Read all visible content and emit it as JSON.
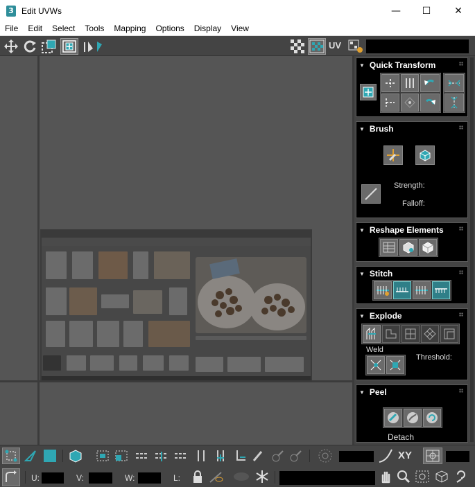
{
  "window": {
    "app_icon": "3",
    "title": "Edit UVWs",
    "minimize_icon": "—",
    "maximize_icon": "☐",
    "close_icon": "✕"
  },
  "menu": [
    "File",
    "Edit",
    "Select",
    "Tools",
    "Mapping",
    "Options",
    "Display",
    "View"
  ],
  "toolbar": {
    "uv_label": "UV",
    "icons": [
      "move-icon",
      "rotate-icon",
      "scale-icon",
      "freeform-icon",
      "mirror-icon",
      "checker-icon",
      "checker-grid-icon",
      "uv-label",
      "settings-icon"
    ]
  },
  "panels": {
    "quick_transform": {
      "title": "Quick Transform"
    },
    "brush": {
      "title": "Brush",
      "strength_label": "Strength:",
      "falloff_label": "Falloff:"
    },
    "reshape": {
      "title": "Reshape Elements"
    },
    "stitch": {
      "title": "Stitch"
    },
    "explode": {
      "title": "Explode",
      "weld_label": "Weld",
      "threshold_label": "Threshold:"
    },
    "peel": {
      "title": "Peel",
      "detach_label": "Detach"
    }
  },
  "bottom": {
    "xy_label": "XY",
    "u_label": "U:",
    "v_label": "V:",
    "w_label": "W:",
    "l_label": "L:"
  },
  "colors": {
    "teal": "#2fa7b3",
    "panel_bg": "#000000",
    "ui_bg": "#444444",
    "viewport_bg": "#555555"
  }
}
